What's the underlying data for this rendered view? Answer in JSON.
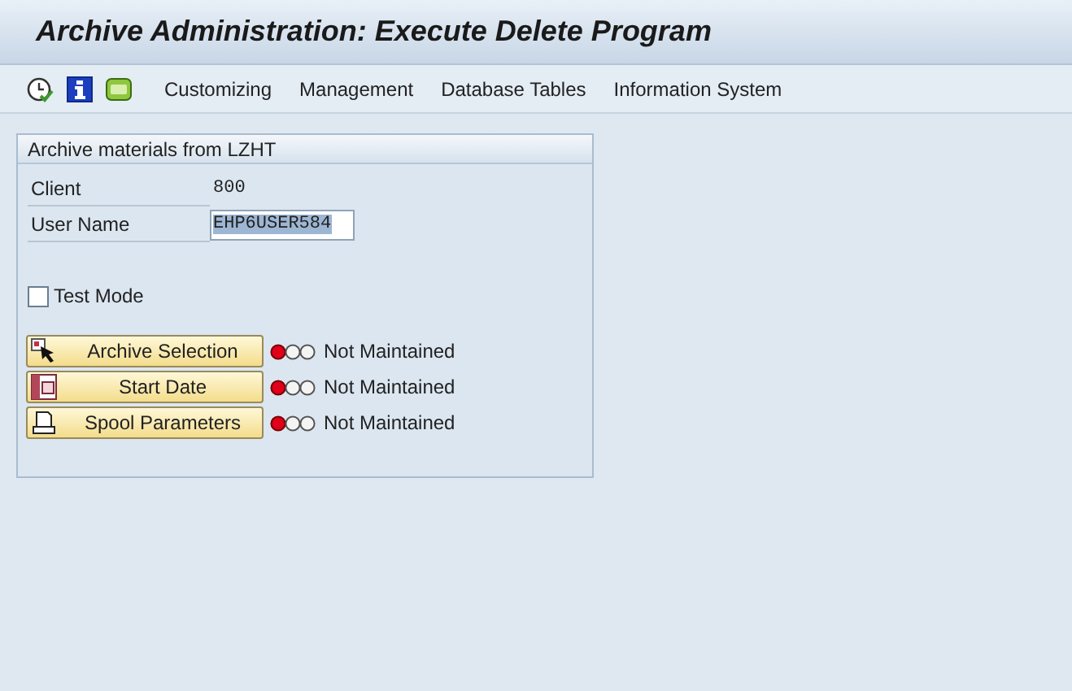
{
  "window": {
    "title": "Archive Administration: Execute Delete Program"
  },
  "menu": [
    "Customizing",
    "Management",
    "Database Tables",
    "Information System"
  ],
  "group": {
    "title": "Archive materials from LZHT",
    "fields": [
      {
        "label": "Client",
        "value": "800",
        "kind": "display"
      },
      {
        "label": "User Name",
        "value": "EHP6USER584",
        "kind": "input",
        "selected": true
      }
    ],
    "test_mode": {
      "label": "Test Mode",
      "checked": false
    },
    "actions": [
      {
        "label": "Archive Selection",
        "kind": "cursor",
        "color": "#e0001a",
        "status_text": "Not Maintained"
      },
      {
        "label": "Start Date",
        "kind": "calendar",
        "color": "#e0001a",
        "status_text": "Not Maintained"
      },
      {
        "label": "Spool Parameters",
        "kind": "printer",
        "color": "#e0001a",
        "status_text": "Not Maintained"
      }
    ]
  }
}
